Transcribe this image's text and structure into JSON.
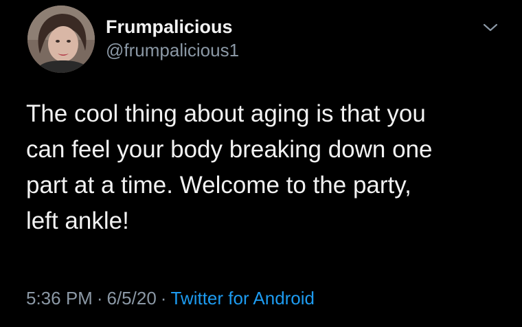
{
  "tweet": {
    "user": {
      "display_name": "Frumpalicious",
      "handle": "@frumpalicious1",
      "avatar_icon": "user-avatar-photo"
    },
    "menu_icon": "chevron-down-icon",
    "text_lines": [
      "The cool thing about aging is that you",
      "can feel your body breaking down one",
      "part at a time. Welcome to the party,",
      "left ankle!"
    ],
    "meta": {
      "time": "5:36 PM",
      "separator": "·",
      "date": "6/5/20",
      "source": "Twitter for Android"
    }
  },
  "colors": {
    "background": "#000000",
    "text": "#f2f2f2",
    "secondary_text": "#8b98a5",
    "link": "#1d9bf0"
  }
}
